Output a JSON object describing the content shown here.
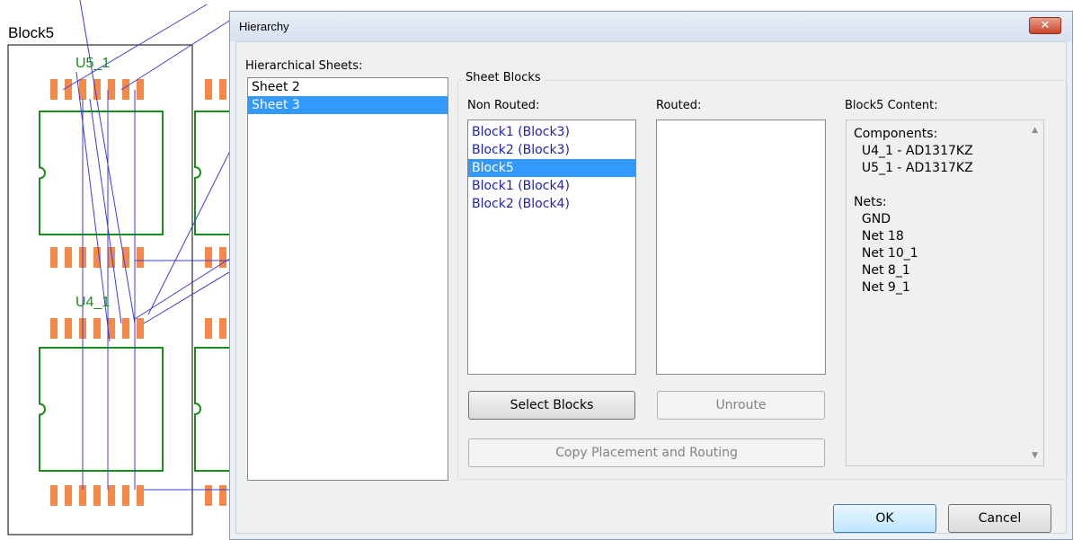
{
  "canvas": {
    "block_label": "Block5",
    "component_labels": [
      "U5_1",
      "U4_1"
    ],
    "colors": {
      "outline": "#1c8c1c",
      "pads": "#f5894a",
      "ratsnest": "#3d3dd6",
      "block_border": "#000000"
    }
  },
  "dialog": {
    "title": "Hierarchy",
    "close_glyph": "✕",
    "hierarchical_sheets_label": "Hierarchical Sheets:",
    "sheets": [
      {
        "label": "Sheet 2",
        "selected": false
      },
      {
        "label": "Sheet 3",
        "selected": true
      }
    ],
    "sheet_blocks_group": "Sheet Blocks",
    "non_routed_label": "Non Routed:",
    "non_routed": [
      {
        "label": "Block1 (Block3)",
        "selected": false
      },
      {
        "label": "Block2 (Block3)",
        "selected": false
      },
      {
        "label": "Block5",
        "selected": true
      },
      {
        "label": "Block1 (Block4)",
        "selected": false
      },
      {
        "label": "Block2 (Block4)",
        "selected": false
      }
    ],
    "routed_label": "Routed:",
    "routed": [],
    "content_label": "Block5 Content:",
    "content_lines": [
      "Components:",
      "  U4_1 - AD1317KZ",
      "  U5_1 - AD1317KZ",
      "",
      "Nets:",
      "  GND",
      "  Net 18",
      "  Net 10_1",
      "  Net 8_1",
      "  Net 9_1"
    ],
    "select_blocks_button": "Select Blocks",
    "unroute_button": "Unroute",
    "copy_button": "Copy Placement and Routing",
    "ok_button": "OK",
    "cancel_button": "Cancel"
  }
}
